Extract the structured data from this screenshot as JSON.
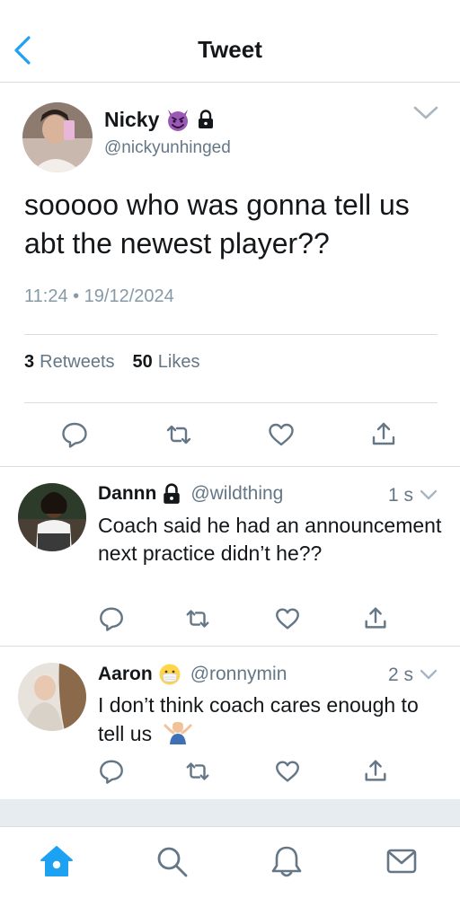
{
  "header": {
    "title": "Tweet"
  },
  "tweet": {
    "name": "Nicky",
    "handle": "@nickyunhinged",
    "text": "sooooo who was gonna tell us abt the newest player??",
    "timestamp": "11:24 • 19/12/2024",
    "retweets_count": "3",
    "retweets_label": "Retweets",
    "likes_count": "50",
    "likes_label": "Likes"
  },
  "replies": [
    {
      "name": "Dannn",
      "handle": "@wildthing",
      "time": "1 s",
      "text": "Coach said he had an announcement next practice didn’t he??"
    },
    {
      "name": "Aaron",
      "handle": "@ronnymin",
      "time": "2 s",
      "text": "I don’t think coach cares enough to tell us"
    }
  ],
  "tabs": [
    "home-icon",
    "search-icon",
    "notifications-icon",
    "messages-icon"
  ],
  "colors": {
    "accent": "#1da1f2",
    "icon_gray": "#657786",
    "divider": "#d6dde3"
  }
}
